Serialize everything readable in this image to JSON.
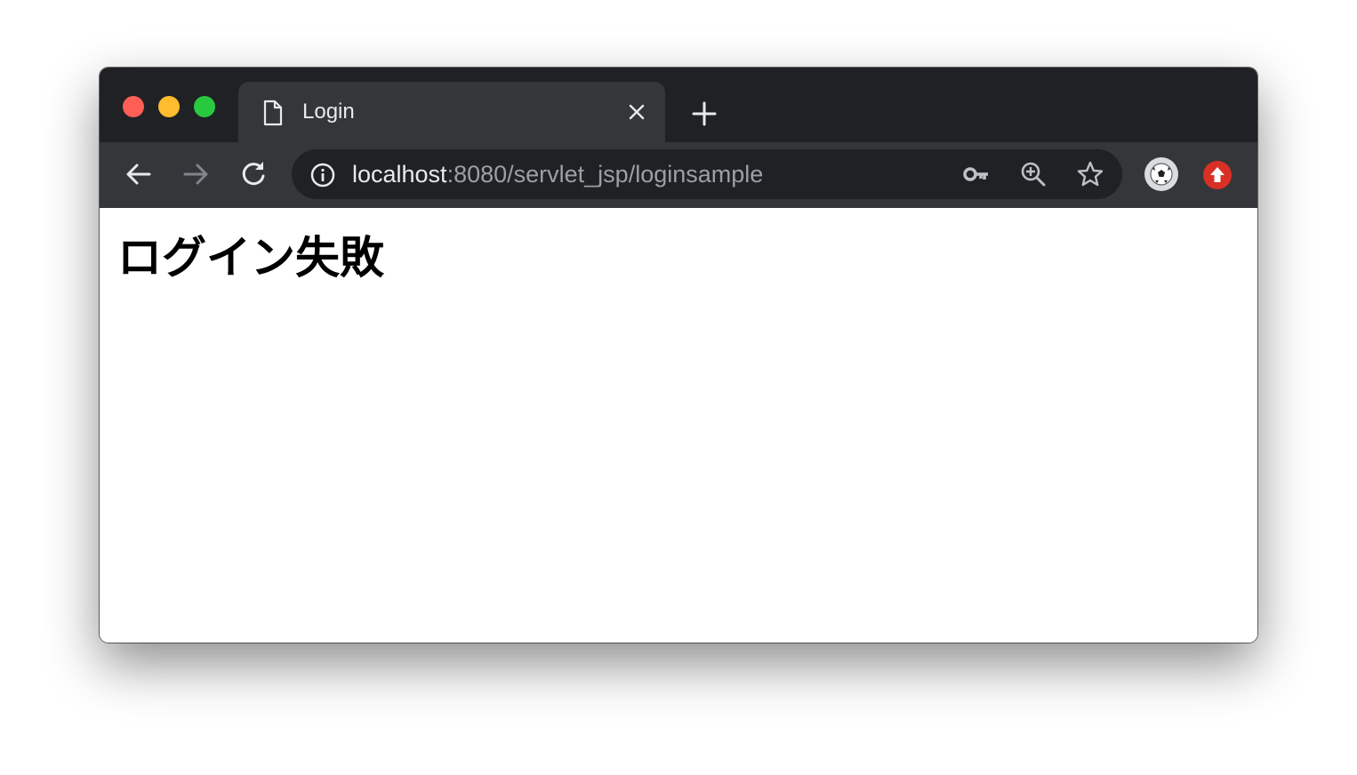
{
  "window": {
    "controls": [
      "close",
      "minimize",
      "maximize"
    ],
    "colors": {
      "close": "#ff5f57",
      "minimize": "#febc2e",
      "maximize": "#28c840"
    }
  },
  "tab": {
    "title": "Login",
    "icon": "page-icon"
  },
  "toolbar": {
    "back_icon": "arrow-left-icon",
    "forward_icon": "arrow-right-icon",
    "reload_icon": "reload-icon"
  },
  "address_bar": {
    "host": "localhost",
    "path": ":8080/servlet_jsp/loginsample",
    "icons": [
      "info-icon",
      "key-icon",
      "zoom-in-icon",
      "star-icon"
    ]
  },
  "extensions": [
    "soccer-ball-icon",
    "update-arrow-icon"
  ],
  "page": {
    "heading": "ログイン失敗"
  }
}
